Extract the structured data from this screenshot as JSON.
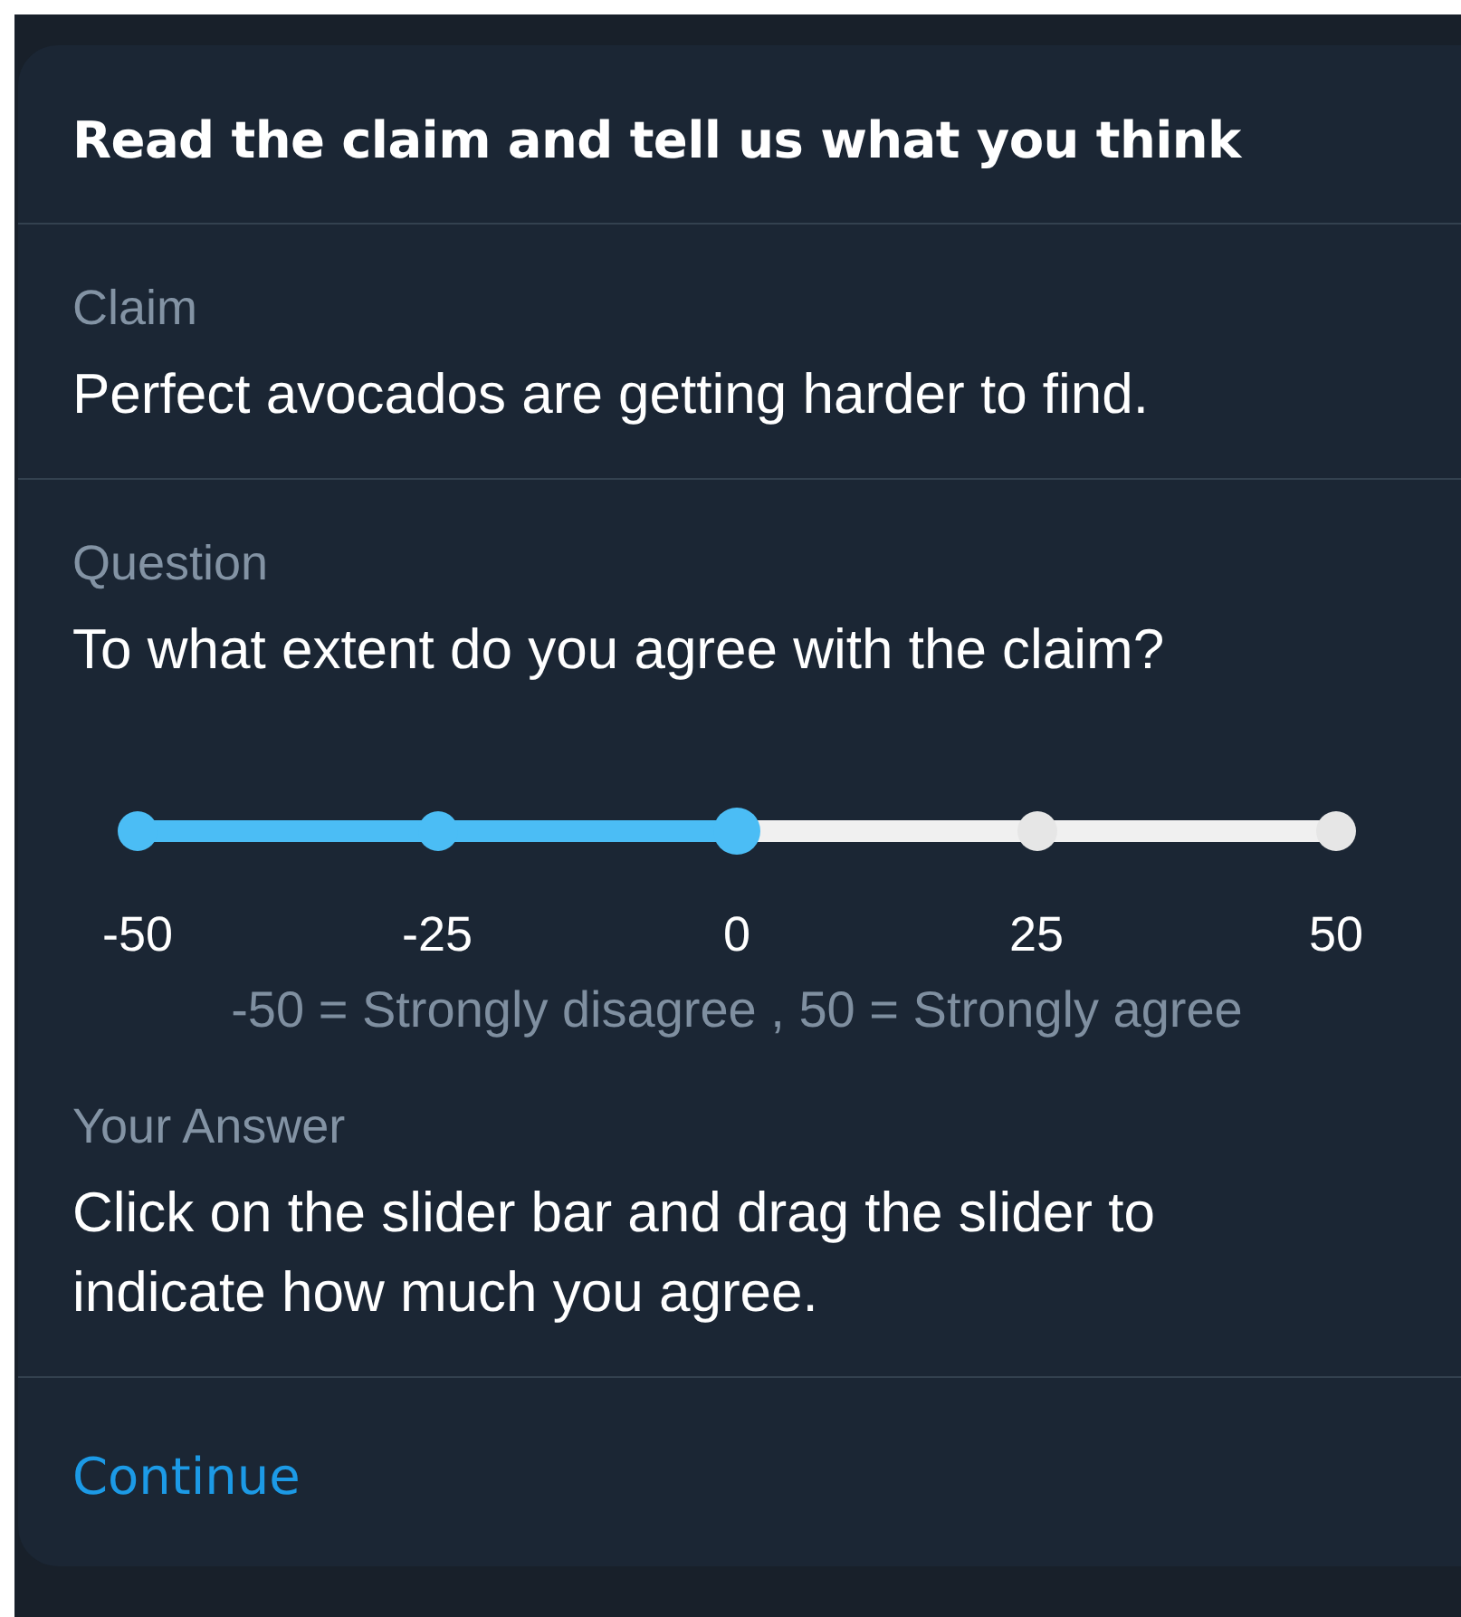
{
  "title": "Read the claim and tell us what you think",
  "claim": {
    "label": "Claim",
    "text": "Perfect avocados are getting harder to find."
  },
  "question": {
    "label": "Question",
    "text": "To what extent do you agree with the claim?"
  },
  "slider": {
    "level": 0.5,
    "ticks": [
      "-50",
      "-25",
      "0",
      "25",
      "50"
    ],
    "caption": "-50 = Strongly disagree , 50 = Strongly agree"
  },
  "answer": {
    "label": "Your Answer",
    "text": "Click on the slider bar and drag the slider to indicate how much you agree."
  },
  "continue_link": "Continue"
}
